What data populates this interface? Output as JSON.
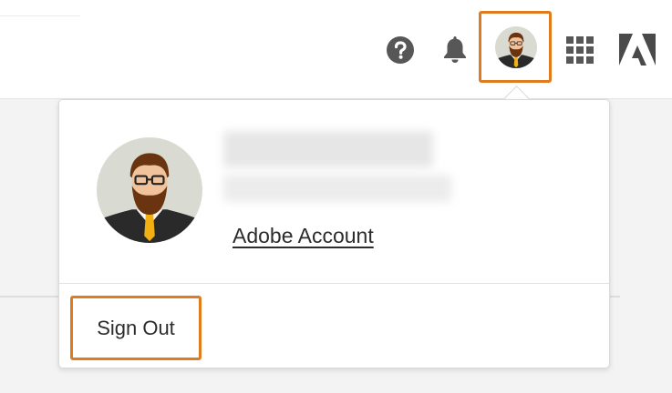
{
  "header": {
    "icons": [
      "help-icon",
      "notifications-bell-icon",
      "user-avatar",
      "apps-grid-icon",
      "adobe-logo"
    ]
  },
  "colors": {
    "highlight": "#e07b20",
    "icon_gray": "#575757",
    "adobe_logo": "#4a4a4a",
    "avatar_bg": "#d9dbd2",
    "hair_beard": "#6b3410",
    "tie": "#f2b012"
  },
  "account_menu": {
    "user_name": "",
    "user_email": "",
    "account_link": "Adobe Account",
    "sign_out": "Sign Out"
  }
}
